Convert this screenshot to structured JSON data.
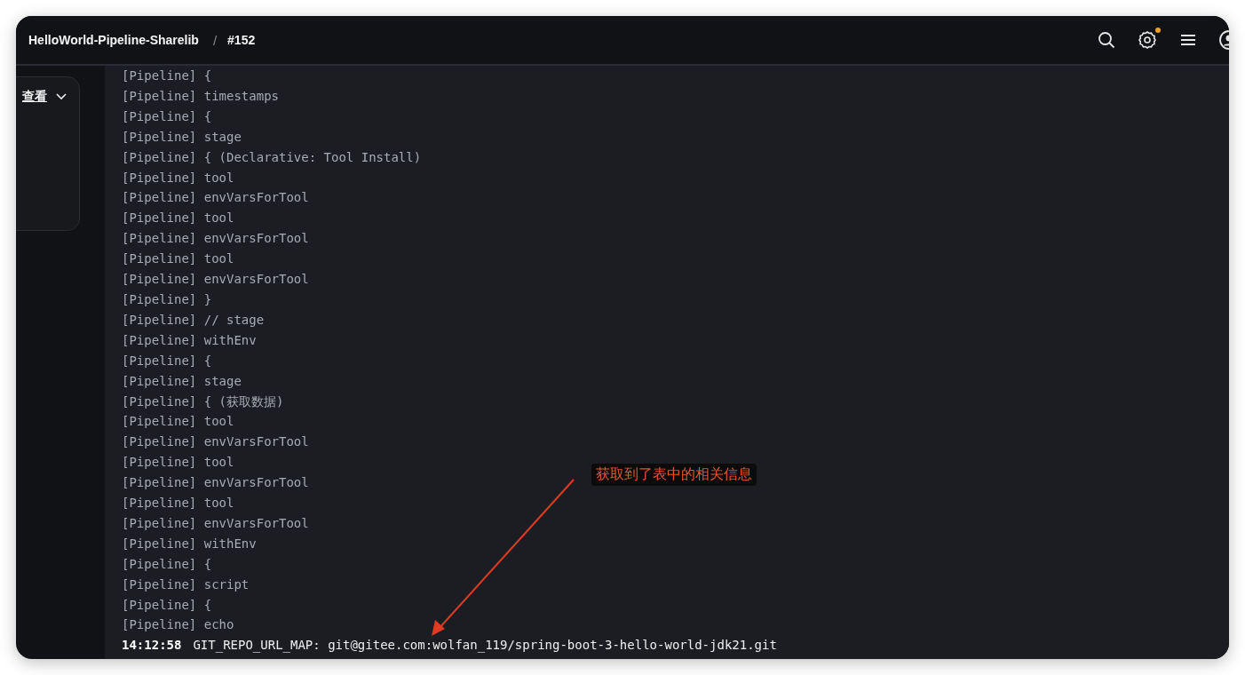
{
  "header": {
    "breadcrumbs": [
      "HelloWorld-Pipeline-Sharelib",
      "#152"
    ],
    "separator": "/",
    "settings_badge": true
  },
  "sidebar": {
    "dropdown_label": "查看"
  },
  "log": {
    "lines": [
      "[Pipeline] {",
      "[Pipeline] timestamps",
      "[Pipeline] {",
      "[Pipeline] stage",
      "[Pipeline] { (Declarative: Tool Install)",
      "[Pipeline] tool",
      "[Pipeline] envVarsForTool",
      "[Pipeline] tool",
      "[Pipeline] envVarsForTool",
      "[Pipeline] tool",
      "[Pipeline] envVarsForTool",
      "[Pipeline] }",
      "[Pipeline] // stage",
      "[Pipeline] withEnv",
      "[Pipeline] {",
      "[Pipeline] stage",
      "[Pipeline] { (获取数据)",
      "[Pipeline] tool",
      "[Pipeline] envVarsForTool",
      "[Pipeline] tool",
      "[Pipeline] envVarsForTool",
      "[Pipeline] tool",
      "[Pipeline] envVarsForTool",
      "[Pipeline] withEnv",
      "[Pipeline] {",
      "[Pipeline] script",
      "[Pipeline] {",
      "[Pipeline] echo"
    ],
    "output": {
      "time": "14:12:58",
      "text": "GIT_REPO_URL_MAP: git@gitee.com:wolfan_119/spring-boot-3-hello-world-jdk21.git"
    }
  },
  "annotation": {
    "text": "获取到了表中的相关信息"
  }
}
